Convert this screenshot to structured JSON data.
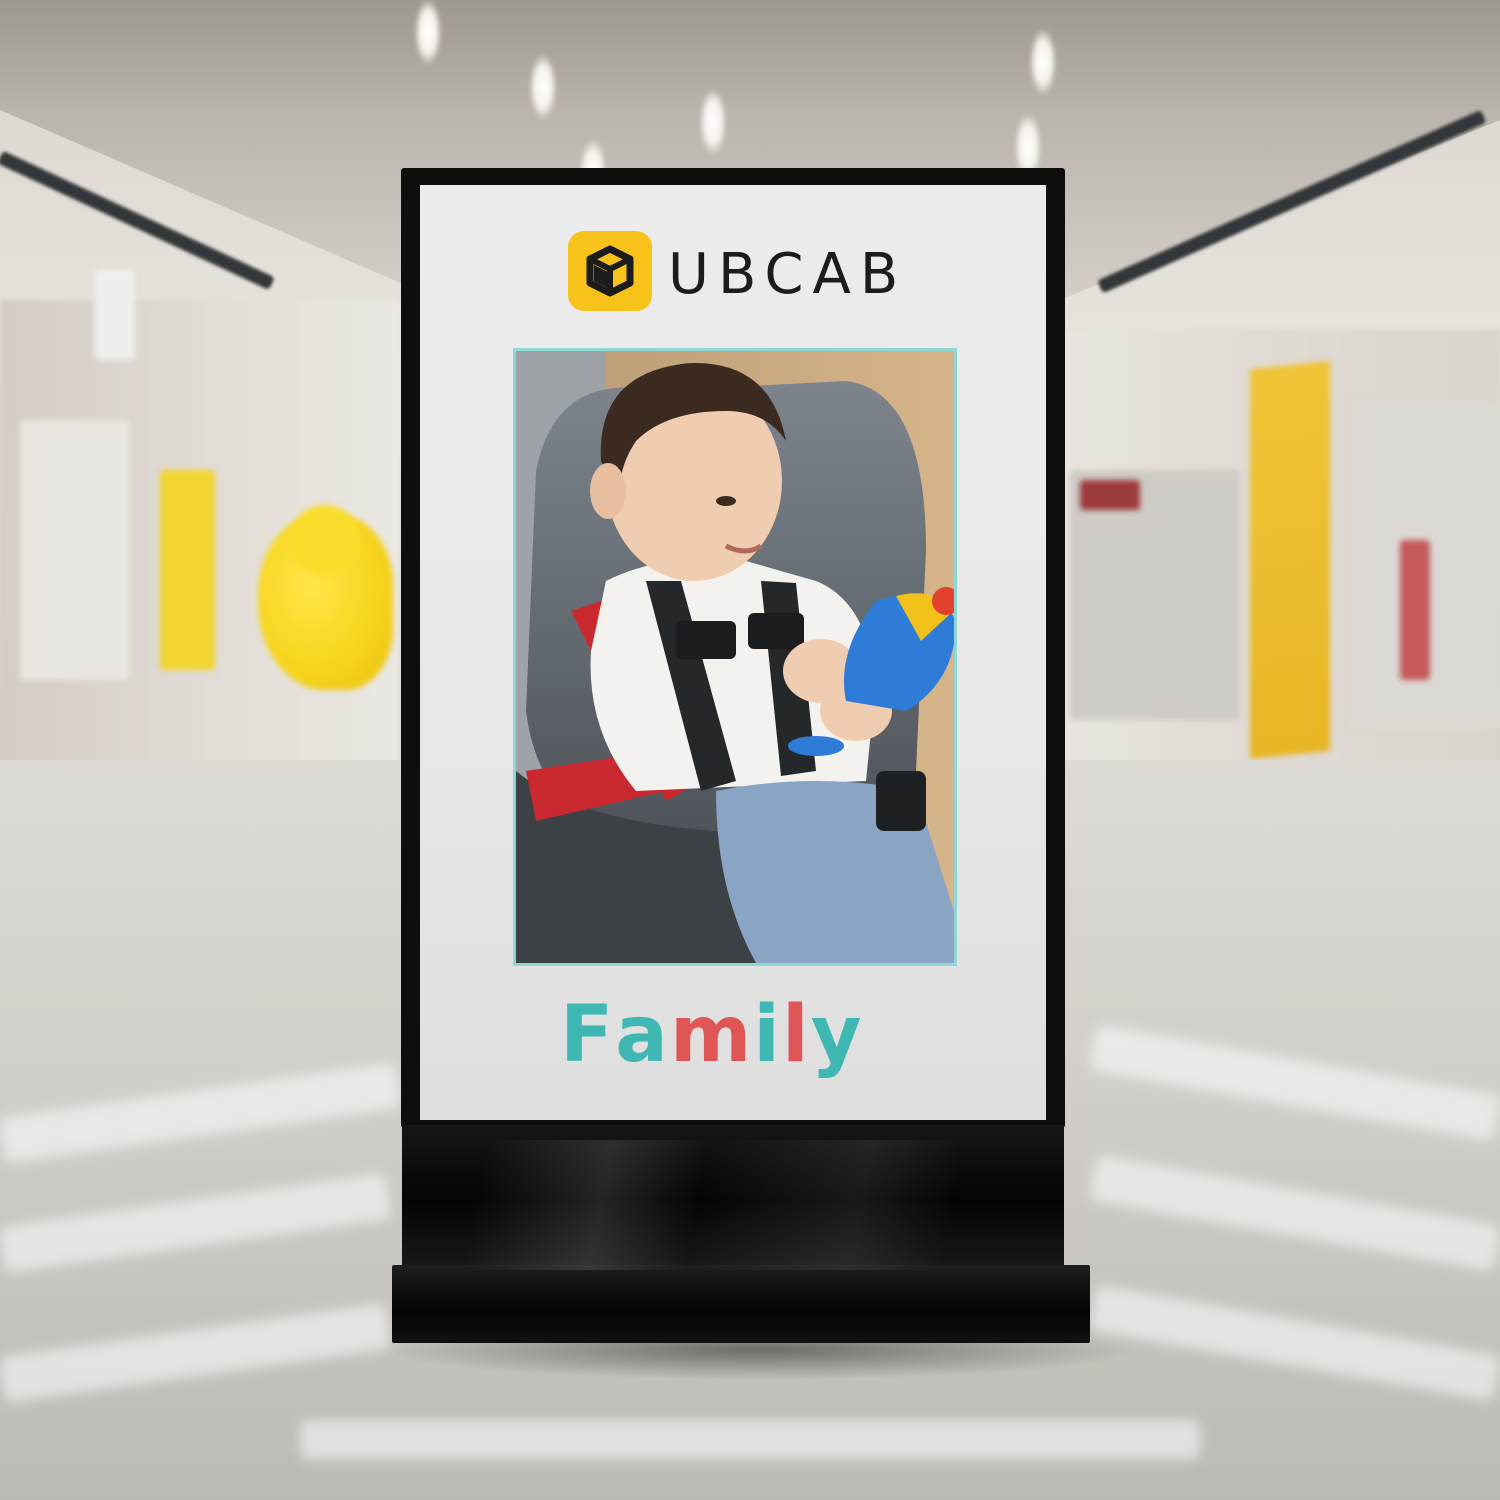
{
  "brand": {
    "name": "UBCAB",
    "icon": "ubcab-cube-logo-icon",
    "icon_color": "#f7c21a",
    "text_color": "#1c1c1c"
  },
  "poster": {
    "word": "Family",
    "letters": [
      {
        "char": "F",
        "color": "#3fb8b4"
      },
      {
        "char": "a",
        "color": "#3fb8b4"
      },
      {
        "char": "m",
        "color": "#e05656"
      },
      {
        "char": "i",
        "color": "#3fb8b4"
      },
      {
        "char": "l",
        "color": "#e05656"
      },
      {
        "char": "y",
        "color": "#3fb8b4"
      }
    ],
    "frame_color": "#8fd7d2"
  },
  "kiosk": {
    "frame_color": "#0e0e0f",
    "screen_color": "#ececec"
  }
}
